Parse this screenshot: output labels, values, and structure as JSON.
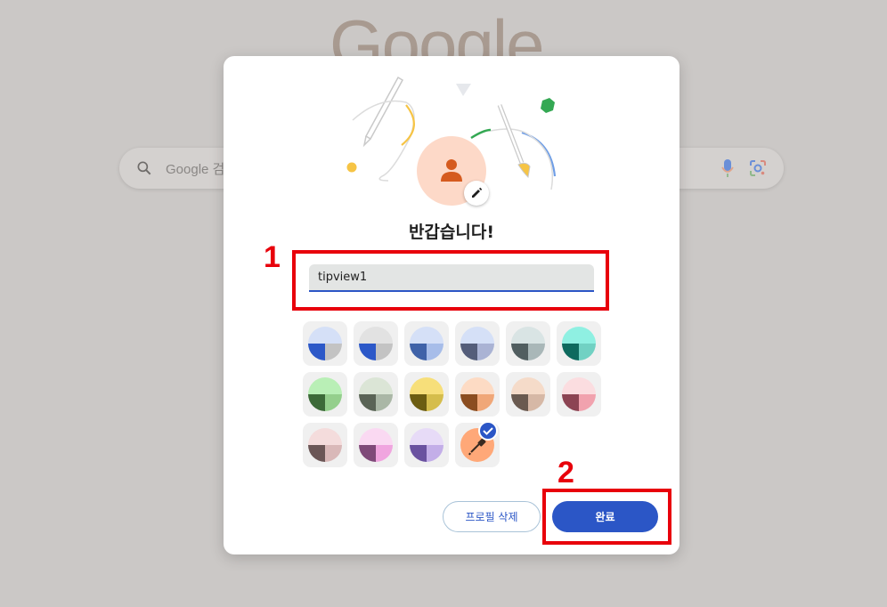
{
  "background": {
    "logo_text": "Google",
    "search_placeholder": "Google 검색 또는 URL 입력",
    "search_icon": "search-icon",
    "mic_icon": "mic-icon",
    "lens_icon": "lens-icon"
  },
  "dialog": {
    "avatar_icon": "person-icon",
    "edit_icon": "pencil-icon",
    "greeting": "반갑습니다!",
    "name_value": "tipview1",
    "swatches": [
      {
        "name": "blue-grey",
        "top": "#d5e0f7",
        "bl": "#2c58c8",
        "br": "#c3c3c3"
      },
      {
        "name": "grey-blue",
        "top": "#e2e2e2",
        "bl": "#2c58c8",
        "br": "#c3c3c3"
      },
      {
        "name": "blue",
        "top": "#d5e0f7",
        "bl": "#3f62a8",
        "br": "#a7bde9"
      },
      {
        "name": "slate",
        "top": "#d5e0f7",
        "bl": "#545d7a",
        "br": "#aab3d4"
      },
      {
        "name": "grey-teal",
        "top": "#d9e4e4",
        "bl": "#515e60",
        "br": "#a9b7b8"
      },
      {
        "name": "aqua",
        "top": "#8ff0e2",
        "bl": "#0e6a5e",
        "br": "#71d1c3"
      },
      {
        "name": "green",
        "top": "#b9efb6",
        "bl": "#3c6a38",
        "br": "#94cf8c"
      },
      {
        "name": "sage",
        "top": "#dbe5d6",
        "bl": "#5a6456",
        "br": "#aab7a6"
      },
      {
        "name": "yellow",
        "top": "#f7df7a",
        "bl": "#6c5d12",
        "br": "#d5bd4c"
      },
      {
        "name": "orange",
        "top": "#fddbc4",
        "bl": "#8b4d20",
        "br": "#f0a778"
      },
      {
        "name": "tan",
        "top": "#f5dbc9",
        "bl": "#6a5a50",
        "br": "#d6b8a6"
      },
      {
        "name": "pink",
        "top": "#fbdde0",
        "bl": "#8c4453",
        "br": "#f1a2ae"
      },
      {
        "name": "rose",
        "top": "#f4dcdc",
        "bl": "#6b5656",
        "br": "#d9b8b8"
      },
      {
        "name": "magenta",
        "top": "#fad9f2",
        "bl": "#7f4a79",
        "br": "#f0a5df"
      },
      {
        "name": "lavender",
        "top": "#e7dbf7",
        "bl": "#6a52a0",
        "br": "#c3aee8"
      }
    ],
    "custom_swatch": {
      "color": "#ffa878",
      "icon": "eyedropper-icon",
      "selected_icon": "checkmark-icon"
    },
    "delete_label": "프로필 삭제",
    "done_label": "완료"
  },
  "annotations": {
    "label_1": "1",
    "label_2": "2",
    "color": "#e8000b"
  }
}
